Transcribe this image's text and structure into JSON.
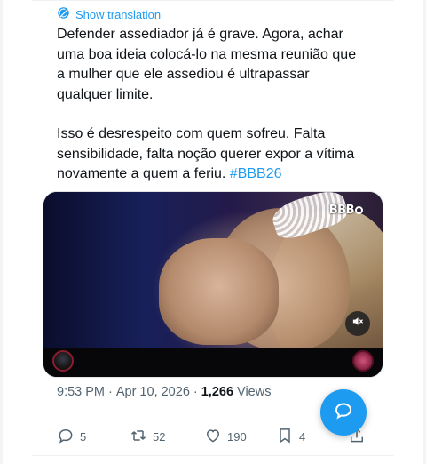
{
  "translation": {
    "label": "Show translation"
  },
  "tweet": {
    "paragraph1": "Defender assediador já é grave. Agora, achar\numa boa ideia colocá-lo na mesma reunião que\na mulher que ele assediou é ultrapassar\nqualquer limite.",
    "paragraph2": "Isso é desrespeito com quem sofreu. Falta\nsensibilidade, falta noção querer expor a vítima\nnovamente a quem a feriu. ",
    "hashtag": "#BBB26"
  },
  "media": {
    "logo_text": "BBB",
    "mute_icon": "speaker-muted-icon"
  },
  "meta": {
    "time": "9:53 PM",
    "separator": "·",
    "date": "Apr 10, 2026",
    "views_count": "1,266",
    "views_label": "Views"
  },
  "actions": {
    "reply_count": "5",
    "retweet_count": "52",
    "like_count": "190",
    "bookmark_count": "4"
  },
  "colors": {
    "accent": "#1d9bf0",
    "text": "#0f1419",
    "secondary": "#536471"
  }
}
